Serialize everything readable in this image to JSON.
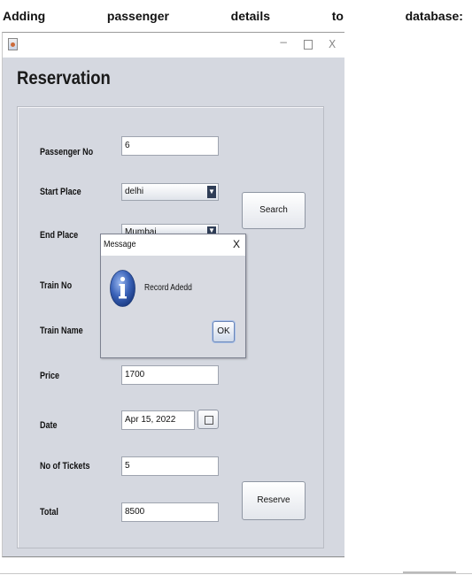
{
  "heading": {
    "words": [
      "Adding",
      "passenger",
      "details",
      "to",
      "database:"
    ]
  },
  "window": {
    "controls": {
      "minimize": "−",
      "close": "X"
    },
    "title": "Reservation"
  },
  "form": {
    "passenger_no": {
      "label": "Passenger No",
      "value": "6"
    },
    "start_place": {
      "label": "Start Place",
      "value": "delhi"
    },
    "end_place": {
      "label": "End Place",
      "value": "Mumbai"
    },
    "train_no": {
      "label": "Train No"
    },
    "train_name": {
      "label": "Train Name"
    },
    "price": {
      "label": "Price",
      "value": "1700"
    },
    "date": {
      "label": "Date",
      "value": "Apr 15, 2022"
    },
    "no_of_tickets": {
      "label": "No of Tickets",
      "value": "5"
    },
    "total": {
      "label": "Total",
      "value": "8500"
    },
    "search_label": "Search",
    "reserve_label": "Reserve"
  },
  "dialog": {
    "title": "Message",
    "close": "X",
    "message": "Record Adedd",
    "ok_label": "OK"
  },
  "colors": {
    "window_bg": "#d5d8e0",
    "info_icon": "#3a62b8"
  }
}
